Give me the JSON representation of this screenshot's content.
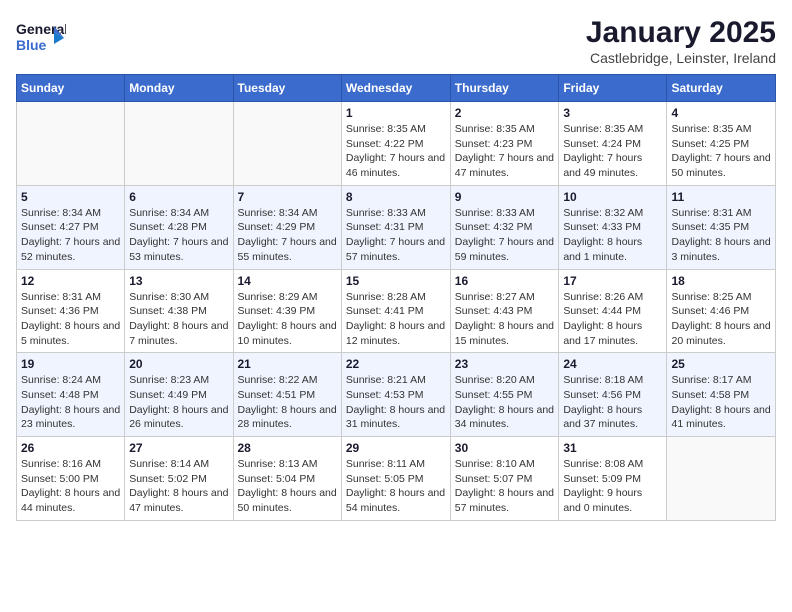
{
  "logo": {
    "line1": "General",
    "line2": "Blue"
  },
  "title": "January 2025",
  "location": "Castlebridge, Leinster, Ireland",
  "weekdays": [
    "Sunday",
    "Monday",
    "Tuesday",
    "Wednesday",
    "Thursday",
    "Friday",
    "Saturday"
  ],
  "weeks": [
    [
      {
        "day": "",
        "info": ""
      },
      {
        "day": "",
        "info": ""
      },
      {
        "day": "",
        "info": ""
      },
      {
        "day": "1",
        "info": "Sunrise: 8:35 AM\nSunset: 4:22 PM\nDaylight: 7 hours and 46 minutes."
      },
      {
        "day": "2",
        "info": "Sunrise: 8:35 AM\nSunset: 4:23 PM\nDaylight: 7 hours and 47 minutes."
      },
      {
        "day": "3",
        "info": "Sunrise: 8:35 AM\nSunset: 4:24 PM\nDaylight: 7 hours and 49 minutes."
      },
      {
        "day": "4",
        "info": "Sunrise: 8:35 AM\nSunset: 4:25 PM\nDaylight: 7 hours and 50 minutes."
      }
    ],
    [
      {
        "day": "5",
        "info": "Sunrise: 8:34 AM\nSunset: 4:27 PM\nDaylight: 7 hours and 52 minutes."
      },
      {
        "day": "6",
        "info": "Sunrise: 8:34 AM\nSunset: 4:28 PM\nDaylight: 7 hours and 53 minutes."
      },
      {
        "day": "7",
        "info": "Sunrise: 8:34 AM\nSunset: 4:29 PM\nDaylight: 7 hours and 55 minutes."
      },
      {
        "day": "8",
        "info": "Sunrise: 8:33 AM\nSunset: 4:31 PM\nDaylight: 7 hours and 57 minutes."
      },
      {
        "day": "9",
        "info": "Sunrise: 8:33 AM\nSunset: 4:32 PM\nDaylight: 7 hours and 59 minutes."
      },
      {
        "day": "10",
        "info": "Sunrise: 8:32 AM\nSunset: 4:33 PM\nDaylight: 8 hours and 1 minute."
      },
      {
        "day": "11",
        "info": "Sunrise: 8:31 AM\nSunset: 4:35 PM\nDaylight: 8 hours and 3 minutes."
      }
    ],
    [
      {
        "day": "12",
        "info": "Sunrise: 8:31 AM\nSunset: 4:36 PM\nDaylight: 8 hours and 5 minutes."
      },
      {
        "day": "13",
        "info": "Sunrise: 8:30 AM\nSunset: 4:38 PM\nDaylight: 8 hours and 7 minutes."
      },
      {
        "day": "14",
        "info": "Sunrise: 8:29 AM\nSunset: 4:39 PM\nDaylight: 8 hours and 10 minutes."
      },
      {
        "day": "15",
        "info": "Sunrise: 8:28 AM\nSunset: 4:41 PM\nDaylight: 8 hours and 12 minutes."
      },
      {
        "day": "16",
        "info": "Sunrise: 8:27 AM\nSunset: 4:43 PM\nDaylight: 8 hours and 15 minutes."
      },
      {
        "day": "17",
        "info": "Sunrise: 8:26 AM\nSunset: 4:44 PM\nDaylight: 8 hours and 17 minutes."
      },
      {
        "day": "18",
        "info": "Sunrise: 8:25 AM\nSunset: 4:46 PM\nDaylight: 8 hours and 20 minutes."
      }
    ],
    [
      {
        "day": "19",
        "info": "Sunrise: 8:24 AM\nSunset: 4:48 PM\nDaylight: 8 hours and 23 minutes."
      },
      {
        "day": "20",
        "info": "Sunrise: 8:23 AM\nSunset: 4:49 PM\nDaylight: 8 hours and 26 minutes."
      },
      {
        "day": "21",
        "info": "Sunrise: 8:22 AM\nSunset: 4:51 PM\nDaylight: 8 hours and 28 minutes."
      },
      {
        "day": "22",
        "info": "Sunrise: 8:21 AM\nSunset: 4:53 PM\nDaylight: 8 hours and 31 minutes."
      },
      {
        "day": "23",
        "info": "Sunrise: 8:20 AM\nSunset: 4:55 PM\nDaylight: 8 hours and 34 minutes."
      },
      {
        "day": "24",
        "info": "Sunrise: 8:18 AM\nSunset: 4:56 PM\nDaylight: 8 hours and 37 minutes."
      },
      {
        "day": "25",
        "info": "Sunrise: 8:17 AM\nSunset: 4:58 PM\nDaylight: 8 hours and 41 minutes."
      }
    ],
    [
      {
        "day": "26",
        "info": "Sunrise: 8:16 AM\nSunset: 5:00 PM\nDaylight: 8 hours and 44 minutes."
      },
      {
        "day": "27",
        "info": "Sunrise: 8:14 AM\nSunset: 5:02 PM\nDaylight: 8 hours and 47 minutes."
      },
      {
        "day": "28",
        "info": "Sunrise: 8:13 AM\nSunset: 5:04 PM\nDaylight: 8 hours and 50 minutes."
      },
      {
        "day": "29",
        "info": "Sunrise: 8:11 AM\nSunset: 5:05 PM\nDaylight: 8 hours and 54 minutes."
      },
      {
        "day": "30",
        "info": "Sunrise: 8:10 AM\nSunset: 5:07 PM\nDaylight: 8 hours and 57 minutes."
      },
      {
        "day": "31",
        "info": "Sunrise: 8:08 AM\nSunset: 5:09 PM\nDaylight: 9 hours and 0 minutes."
      },
      {
        "day": "",
        "info": ""
      }
    ]
  ]
}
